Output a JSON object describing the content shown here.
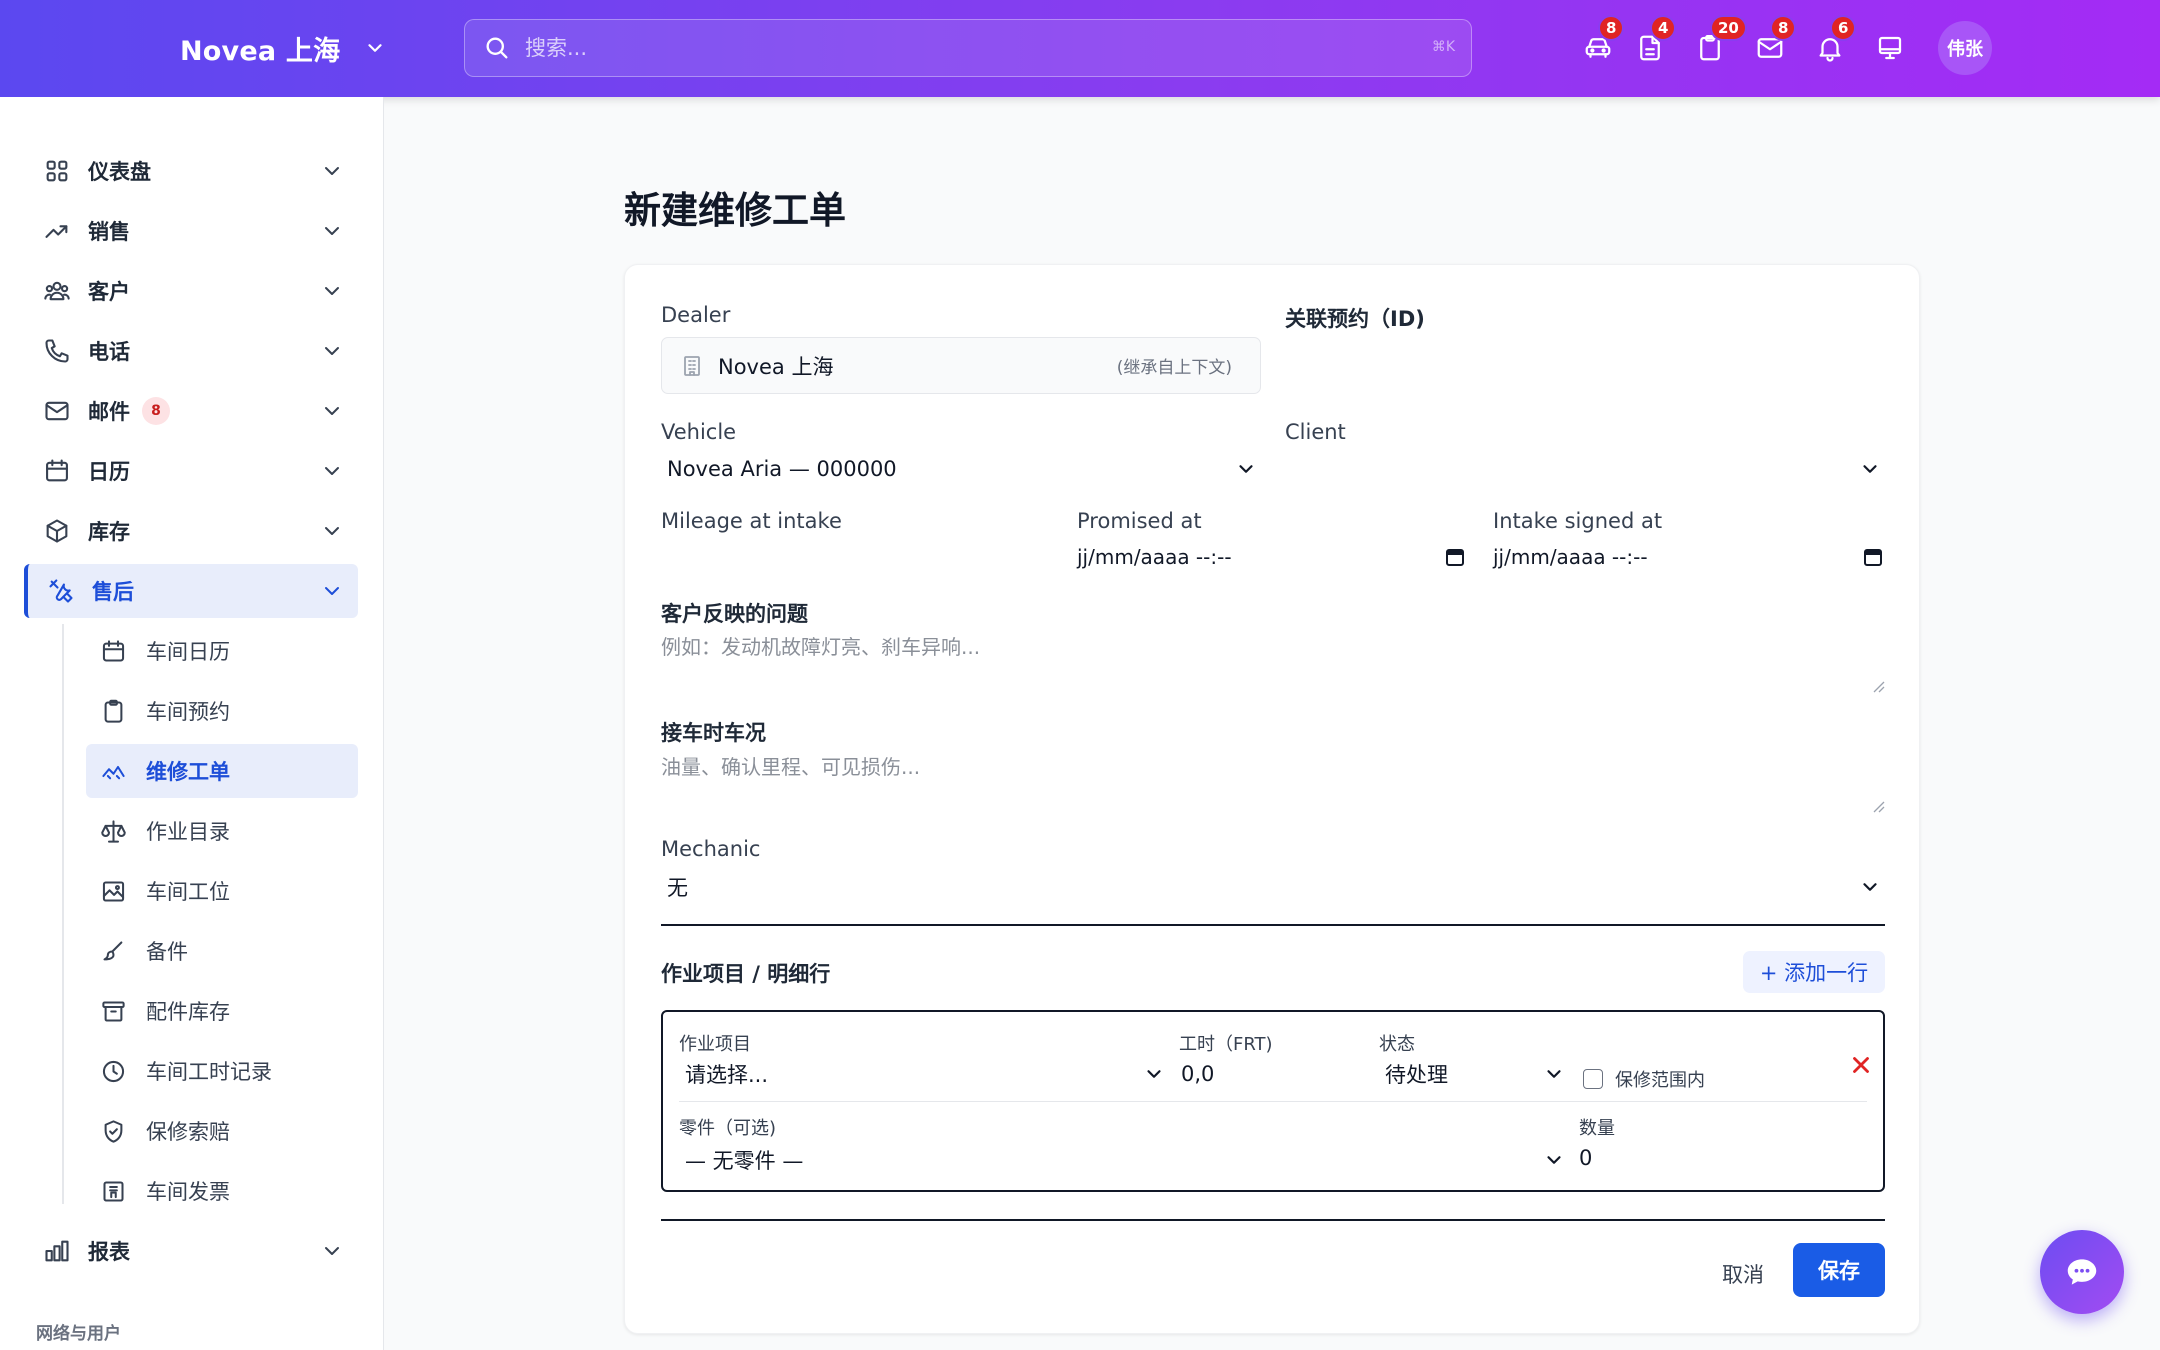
{
  "app": {
    "brand": "Novea 上海",
    "search_placeholder": "搜索...",
    "search_shortcut": "⌘K",
    "user_initials": "伟张"
  },
  "header_icons": [
    {
      "icon": "car-icon",
      "badge": "8"
    },
    {
      "icon": "document-icon",
      "badge": "4"
    },
    {
      "icon": "clipboard-icon",
      "badge": "20"
    },
    {
      "icon": "mail-icon",
      "badge": "8"
    },
    {
      "icon": "bell-icon",
      "badge": "6"
    },
    {
      "icon": "monitor-icon",
      "badge": ""
    }
  ],
  "sidebar": {
    "items": [
      {
        "label": "仪表盘",
        "icon": "grid-icon"
      },
      {
        "label": "销售",
        "icon": "trending-up-icon"
      },
      {
        "label": "客户",
        "icon": "users-icon"
      },
      {
        "label": "电话",
        "icon": "phone-icon"
      },
      {
        "label": "邮件",
        "icon": "mail-icon",
        "badge": "8"
      },
      {
        "label": "日历",
        "icon": "calendar-icon"
      },
      {
        "label": "库存",
        "icon": "box-icon"
      },
      {
        "label": "售后",
        "icon": "tools-icon",
        "active": true
      }
    ],
    "sub_items": [
      {
        "label": "车间日历",
        "icon": "calendar-icon"
      },
      {
        "label": "车间预约",
        "icon": "clipboard-icon"
      },
      {
        "label": "维修工单",
        "icon": "wrench-icon",
        "active": true
      },
      {
        "label": "作业目录",
        "icon": "scale-icon"
      },
      {
        "label": "车间工位",
        "icon": "image-icon"
      },
      {
        "label": "备件",
        "icon": "brush-icon"
      },
      {
        "label": "配件库存",
        "icon": "archive-icon"
      },
      {
        "label": "车间工时记录",
        "icon": "clock-icon"
      },
      {
        "label": "保修索赔",
        "icon": "shield-icon"
      },
      {
        "label": "车间发票",
        "icon": "invoice-icon"
      }
    ],
    "reports": {
      "label": "报表",
      "icon": "bar-chart-icon"
    },
    "section_label": "网络与用户"
  },
  "form": {
    "title": "新建维修工单",
    "dealer_label": "Dealer",
    "dealer_value": "Novea 上海",
    "dealer_hint": "(继承自上下文)",
    "appointment_label": "关联预约（ID)",
    "vehicle_label": "Vehicle",
    "vehicle_value": "Novea Aria — 000000",
    "client_label": "Client",
    "client_value": "",
    "mileage_label": "Mileage at intake",
    "promised_label": "Promised at",
    "promised_value": "jj/mm/aaaa --:--",
    "intake_label": "Intake signed at",
    "intake_value": "jj/mm/aaaa --:--",
    "complaint_label": "客户反映的问题",
    "complaint_placeholder": "例如：发动机故障灯亮、刹车异响...",
    "condition_label": "接车时车况",
    "condition_placeholder": "油量、确认里程、可见损伤...",
    "mechanic_label": "Mechanic",
    "mechanic_value": "无",
    "lines_title": "作业项目 / 明细行",
    "add_line": "+ 添加一行",
    "line": {
      "operation_label": "作业项目",
      "operation_value": "请选择...",
      "frt_label": "工时（FRT)",
      "frt_value": "0,0",
      "status_label": "状态",
      "status_value": "待处理",
      "warranty_label": "保修范围内",
      "part_label": "零件（可选)",
      "part_value": "— 无零件 —",
      "qty_label": "数量",
      "qty_value": "0"
    },
    "cancel": "取消",
    "save": "保存"
  },
  "colors": {
    "accent": "#1a5ce6",
    "topbar_start": "#5b48f0",
    "topbar_end": "#a42bf5",
    "badge": "#e02424"
  }
}
